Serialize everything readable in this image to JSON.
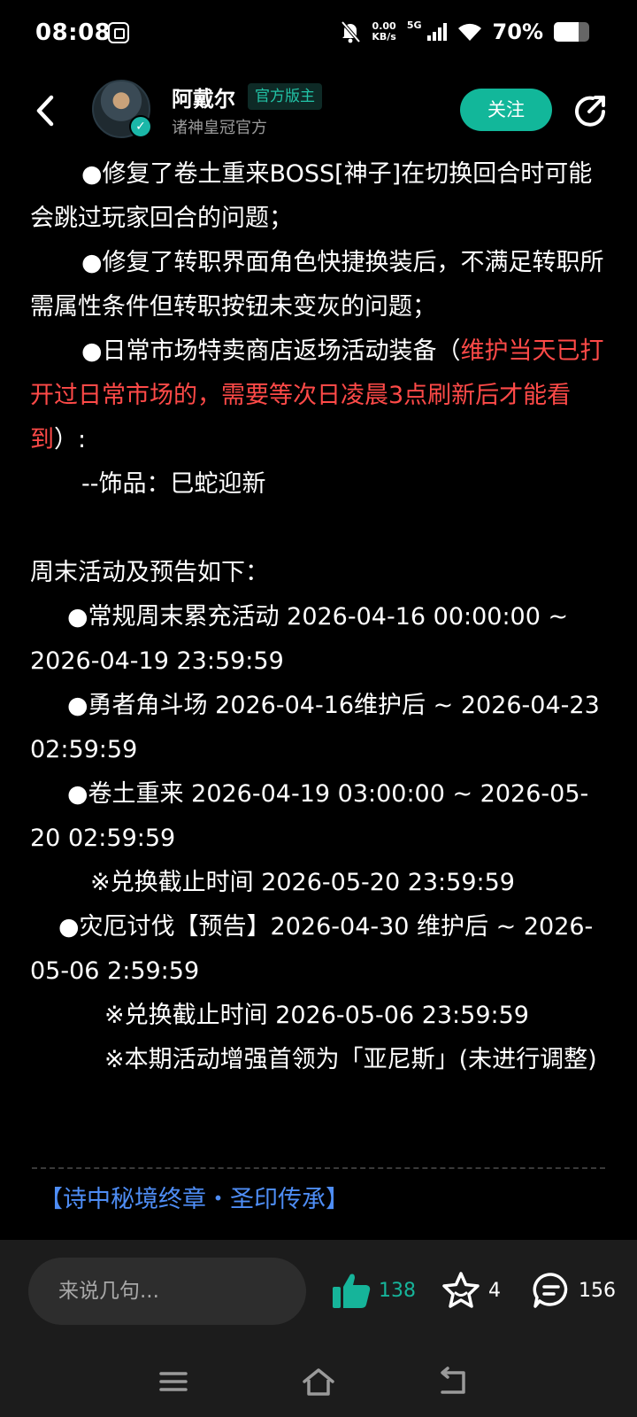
{
  "status_bar": {
    "time": "08:08",
    "net_speed_value": "0.00",
    "net_speed_unit": "KB/s",
    "network": "5G",
    "battery_text": "70%",
    "battery_level": 0.7
  },
  "header": {
    "author_name": "阿戴尔",
    "role_badge": "官方版主",
    "author_subtitle": "诸神皇冠官方",
    "follow_label": "关注"
  },
  "article": {
    "fix1": "●修复了卷土重来BOSS[神子]在切换回合时可能会跳过玩家回合的问题；",
    "fix2": "●修复了转职界面角色快捷换装后，不满足转职所需属性条件但转职按钮未变灰的问题；",
    "shop_prefix": "●日常市场特卖商店返场活动装备（",
    "shop_red": "维护当天已打开过日常市场的，需要等次日凌晨3点刷新后才能看到",
    "shop_suffix": "）:",
    "shop_item": "--饰品：巳蛇迎新",
    "weekend_heading": "周末活动及预告如下：",
    "event1": "●常规周末累充活动 2026-04-16 00:00:00 ~ 2026-04-19 23:59:59",
    "event2": "●勇者角斗场 2026-04-16维护后 ~ 2026-04-23 02:59:59",
    "event3": "●卷土重来 2026-04-19 03:00:00 ~ 2026-05-20 02:59:59",
    "event3_note": "※兑换截止时间 2026-05-20 23:59:59",
    "event4": "●灾厄讨伐【预告】2026-04-30 维护后 ~ 2026-05-06 2:59:59",
    "event4_note1": "※兑换截止时间 2026-05-06 23:59:59",
    "event4_note2": "※本期活动增强首领为「亚尼斯」(未进行调整)",
    "section_link": "【诗中秘境终章・圣印传承】"
  },
  "bottom_bar": {
    "comment_placeholder": "来说几句...",
    "likes": "138",
    "favorites": "4",
    "comments": "156"
  },
  "colors": {
    "accent": "#12b79a",
    "highlight_red": "#ff4a48",
    "link_blue": "#4e8df5"
  },
  "icons": [
    "app-notification-icon",
    "mute-icon",
    "wifi-icon",
    "signal-icon",
    "battery-icon",
    "back-icon",
    "verified-icon",
    "share-icon",
    "thumbs-up-icon",
    "star-icon",
    "comment-icon",
    "menu-icon",
    "home-icon",
    "back-nav-icon"
  ]
}
